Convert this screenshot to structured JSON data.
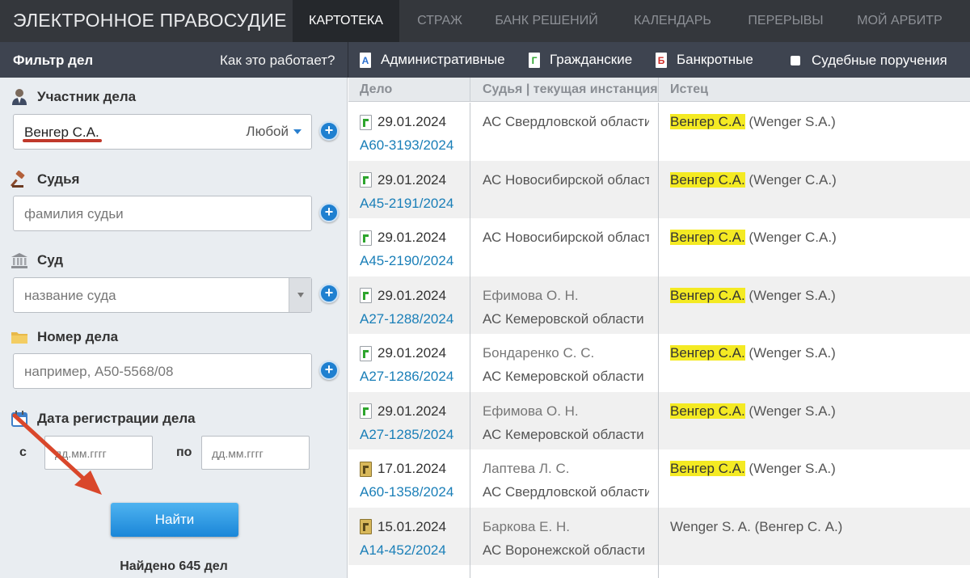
{
  "header": {
    "brand": "ЭЛЕКТРОННОЕ ПРАВОСУДИЕ",
    "nav": [
      {
        "label": "КАРТОТЕКА",
        "active": true
      },
      {
        "label": "СТРАЖ",
        "active": false
      },
      {
        "label": "БАНК РЕШЕНИЙ",
        "active": false
      },
      {
        "label": "КАЛЕНДАРЬ",
        "active": false
      },
      {
        "label": "ПЕРЕРЫВЫ",
        "active": false
      },
      {
        "label": "МОЙ АРБИТР",
        "active": false
      }
    ]
  },
  "subbar": {
    "filter_title": "Фильтр дел",
    "how_it_works": "Как это работает?",
    "categories": [
      {
        "letter": "А",
        "label": "Административные",
        "color": "#2b6fcf"
      },
      {
        "letter": "Г",
        "label": "Гражданские",
        "color": "#2da52d"
      },
      {
        "letter": "Б",
        "label": "Банкротные",
        "color": "#d0302a"
      }
    ],
    "court_orders_label": "Судебные поручения"
  },
  "filter": {
    "participant": {
      "label": "Участник дела",
      "value": "Венгер С.А.",
      "role": "Любой"
    },
    "judge": {
      "label": "Судья",
      "placeholder": "фамилия судьи"
    },
    "court": {
      "label": "Суд",
      "placeholder": "название суда"
    },
    "case_number": {
      "label": "Номер дела",
      "placeholder": "например, А50-5568/08"
    },
    "reg_date": {
      "label": "Дата регистрации дела",
      "from_label": "с",
      "to_label": "по",
      "from_placeholder": "дд.мм.гггг",
      "to_placeholder": "дд.мм.гггг"
    },
    "find_button": "Найти",
    "found_text": "Найдено 645 дел"
  },
  "table": {
    "headers": {
      "case": "Дело",
      "judge": "Судья | текущая инстанция",
      "plaintiff": "Истец"
    },
    "rows": [
      {
        "date": "29.01.2024",
        "case": "А60-3193/2024",
        "judge": "",
        "court": "АС Свердловской области",
        "plaintiff_hl": "Венгер С.А.",
        "plaintiff_rest": " (Wenger S.A.)",
        "archive": false
      },
      {
        "date": "29.01.2024",
        "case": "А45-2191/2024",
        "judge": "",
        "court": "АС Новосибирской области",
        "plaintiff_hl": "Венгер С.А.",
        "plaintiff_rest": " (Wenger С.А.)",
        "archive": false
      },
      {
        "date": "29.01.2024",
        "case": "А45-2190/2024",
        "judge": "",
        "court": "АС Новосибирской области",
        "plaintiff_hl": "Венгер С.А.",
        "plaintiff_rest": " (Wenger С.А.)",
        "archive": false
      },
      {
        "date": "29.01.2024",
        "case": "А27-1288/2024",
        "judge": "Ефимова О. Н.",
        "court": "АС Кемеровской области",
        "plaintiff_hl": "Венгер С.А.",
        "plaintiff_rest": " (Wenger S.A.)",
        "archive": false
      },
      {
        "date": "29.01.2024",
        "case": "А27-1286/2024",
        "judge": "Бондаренко С. С.",
        "court": "АС Кемеровской области",
        "plaintiff_hl": "Венгер С.А.",
        "plaintiff_rest": " (Wenger S.A.)",
        "archive": false
      },
      {
        "date": "29.01.2024",
        "case": "А27-1285/2024",
        "judge": "Ефимова О. Н.",
        "court": "АС Кемеровской области",
        "plaintiff_hl": "Венгер С.А.",
        "plaintiff_rest": " (Wenger S.A.)",
        "archive": false
      },
      {
        "date": "17.01.2024",
        "case": "А60-1358/2024",
        "judge": "Лаптева Л. С.",
        "court": "АС Свердловской области",
        "plaintiff_hl": "Венгер С.А.",
        "plaintiff_rest": " (Wenger S.A.)",
        "archive": true
      },
      {
        "date": "15.01.2024",
        "case": "А14-452/2024",
        "judge": "Баркова Е. Н.",
        "court": "АС Воронежской области",
        "plaintiff_hl": "",
        "plaintiff_rest": "Wenger S. A. (Венгер С. А.)",
        "archive": true
      }
    ]
  },
  "colors": {
    "accent": "#1f80d0",
    "highlight": "#f4ea23",
    "annotation": "#d9472b"
  }
}
